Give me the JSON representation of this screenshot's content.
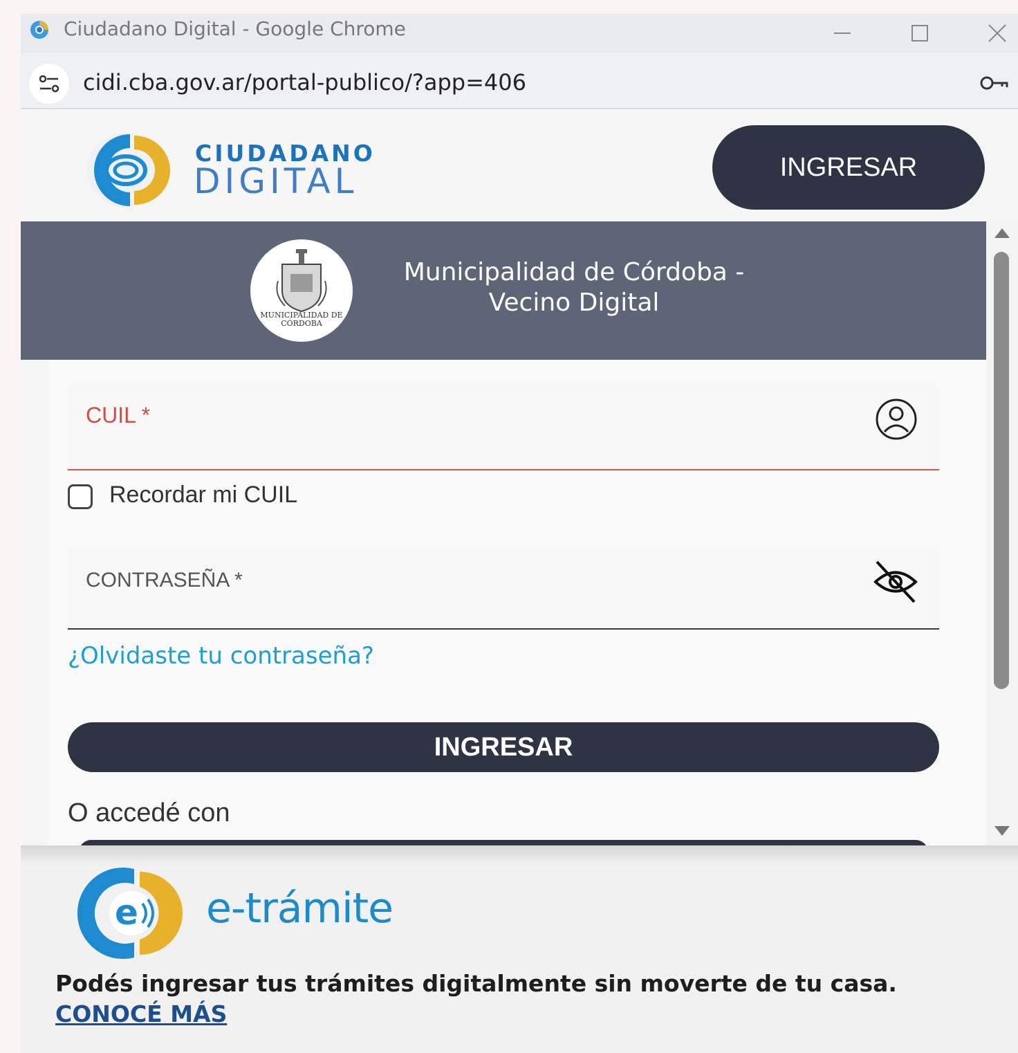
{
  "window": {
    "title": "Ciudadano Digital - Google Chrome",
    "url": "cidi.cba.gov.ar/portal-publico/?app=406"
  },
  "header": {
    "brand_line1": "CIUDADANO",
    "brand_line2": "DIGITAL",
    "ingresar_label": "INGRESAR"
  },
  "banner": {
    "seal_text": "MUNICIPALIDAD DE CÓRDOBA",
    "title_line1": "Municipalidad de Córdoba -",
    "title_line2": "Vecino Digital"
  },
  "form": {
    "cuil_label": "CUIL *",
    "remember_label": "Recordar mi CUIL",
    "remember_checked": false,
    "password_label": "CONTRASEÑA *",
    "forgot_link": "¿Olvidaste tu contraseña?",
    "submit_label": "INGRESAR",
    "alt_login_label": "O accedé con"
  },
  "promo": {
    "brand": "e-trámite",
    "text": "Podés ingresar tus trámites digitalmente sin moverte de tu casa.",
    "link": "CONOCÉ MÁS"
  },
  "colors": {
    "dark_button": "#2e3444",
    "banner": "#5d6577",
    "error_red": "#d14b47",
    "link_blue": "#1f9fd0",
    "brand_blue": "#1d73bb",
    "brand_yellow": "#e8b12a"
  },
  "icons": [
    "chrome-logo-icon",
    "site-info-icon",
    "key-icon",
    "user-icon",
    "eye-off-icon",
    "minimize-icon",
    "maximize-icon",
    "close-icon"
  ]
}
